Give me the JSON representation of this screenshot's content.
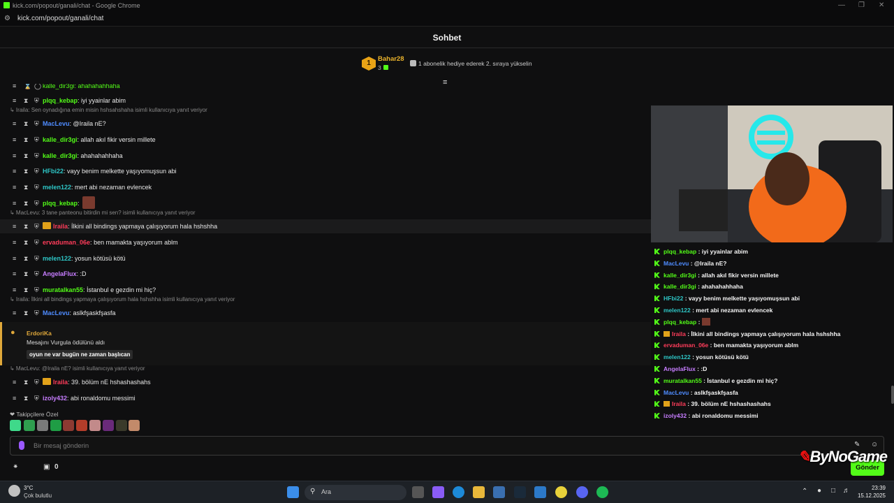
{
  "window": {
    "title": "kick.com/popout/ganali/chat - Google Chrome",
    "url": "kick.com/popout/ganali/chat"
  },
  "header": {
    "title": "Sohbet"
  },
  "pinned": {
    "rank": "1",
    "user": "Bahar28",
    "count": "3",
    "gift_text": "1 abonelik hediye ederek 2. sıraya yükselin"
  },
  "messages": [
    {
      "user": "plqq_kebap",
      "color": "#53fc18",
      "text": "iyi yyainlar abim"
    },
    {
      "user": "MacLevu",
      "color": "#4f8cff",
      "text": "@Iraila nE?",
      "reply": "Iraila: Sen oynadığına emin misin hshsahshaha isimli kullanıcıya yanıt veriyor"
    },
    {
      "user": "kalle_dir3gi",
      "color": "#53fc18",
      "text": "allah akıl fikir versin millete"
    },
    {
      "user": "kalle_dir3gi",
      "color": "#53fc18",
      "text": "ahahahahhaha"
    },
    {
      "user": "HFbi22",
      "color": "#2ec7c7",
      "text": "vayy benim melkette yaşıyomuşsun abi"
    },
    {
      "user": "melen122",
      "color": "#2ec7c7",
      "text": "mert abi nezaman evlencek"
    },
    {
      "user": "plqq_kebap",
      "color": "#53fc18",
      "text": "",
      "emote": true
    },
    {
      "user": "Iraila",
      "color": "#ff3c5a",
      "text": "İlkini all bindings yapmaya çalışıyorum hala hshshha",
      "crown": true,
      "reply": "MacLevu: 3 tane panteonu bitirdin mi sen? isimli kullanıcıya yanıt veriyor"
    },
    {
      "user": "ervaduman_06e",
      "color": "#ff3c5a",
      "text": "ben mamakta yaşıyorum ablm"
    },
    {
      "user": "melen122",
      "color": "#2ec7c7",
      "text": "yosun kötüsü kötü"
    },
    {
      "user": "AngelaFlux",
      "color": "#c77dff",
      "text": ":D"
    },
    {
      "user": "muratalkan55",
      "color": "#53fc18",
      "text": "İstanbul e gezdin mi hiç?"
    },
    {
      "user": "MacLevu",
      "color": "#4f8cff",
      "text": "aslkfşaskfşasfa",
      "reply": "Iraila: İlkini all bindings yapmaya çalışıyorum hala hshshha isimli kullanıcıya yanıt veriyor"
    },
    {
      "user": "Iraila",
      "color": "#ff3c5a",
      "text": "39. bölüm nE hshashashahs",
      "crown": true,
      "reply": "MacLevu: @Iraila nE? isimli kullanıcıya yanıt veriyor"
    },
    {
      "user": "izoly432",
      "color": "#c77dff",
      "text": "abi ronaldomu messimi"
    }
  ],
  "top_partial": "kalle_dir3gi: ahahahahhaha",
  "reward": {
    "user": "ErdoriKa",
    "text": "Mesajını Vurgula ödülünü aldı",
    "highlight": "oyun ne var bugün ne zaman başlıcan"
  },
  "followers_label": "Takipçilere Özel",
  "input": {
    "placeholder": "Bir mesaj gönderin"
  },
  "bottom": {
    "count": "0",
    "send_label": "Gönder"
  },
  "watermark": "ByNoGame",
  "overlay_messages": [
    {
      "user": "plqq_kebap",
      "color": "#53fc18",
      "text": "iyi yyainlar abim"
    },
    {
      "user": "MacLevu",
      "color": "#4f8cff",
      "text": "@Iraila nE?"
    },
    {
      "user": "kalle_dir3gi",
      "color": "#53fc18",
      "text": "allah akıl fikir versin millete"
    },
    {
      "user": "kalle_dir3gi",
      "color": "#53fc18",
      "text": "ahahahahhaha"
    },
    {
      "user": "HFbi22",
      "color": "#2ec7c7",
      "text": "vayy benim melkette yaşıyomuşsun abi"
    },
    {
      "user": "melen122",
      "color": "#2ec7c7",
      "text": "mert abi nezaman evlencek"
    },
    {
      "user": "plqq_kebap",
      "color": "#53fc18",
      "text": "",
      "emote": true
    },
    {
      "user": "Iraila",
      "color": "#ff3c5a",
      "text": "İlkini all bindings yapmaya çalışıyorum hala hshshha",
      "crown": true
    },
    {
      "user": "ervaduman_06e",
      "color": "#ff3c5a",
      "text": "ben mamakta yaşıyorum ablm"
    },
    {
      "user": "melen122",
      "color": "#2ec7c7",
      "text": "yosun kötüsü kötü"
    },
    {
      "user": "AngelaFlux",
      "color": "#c77dff",
      "text": ":D"
    },
    {
      "user": "muratalkan55",
      "color": "#53fc18",
      "text": "İstanbul e gezdin mi hiç?"
    },
    {
      "user": "MacLevu",
      "color": "#4f8cff",
      "text": "aslkfşaskfşasfa"
    },
    {
      "user": "Iraila",
      "color": "#ff3c5a",
      "text": "39. bölüm nE hshashashahs",
      "crown": true
    },
    {
      "user": "izoly432",
      "color": "#c77dff",
      "text": "abi ronaldomu messimi"
    }
  ],
  "taskbar": {
    "temp": "3°C",
    "weather": "Çok bulutlu",
    "search": "Ara",
    "time": "23:39",
    "date": "15.12.2025"
  }
}
